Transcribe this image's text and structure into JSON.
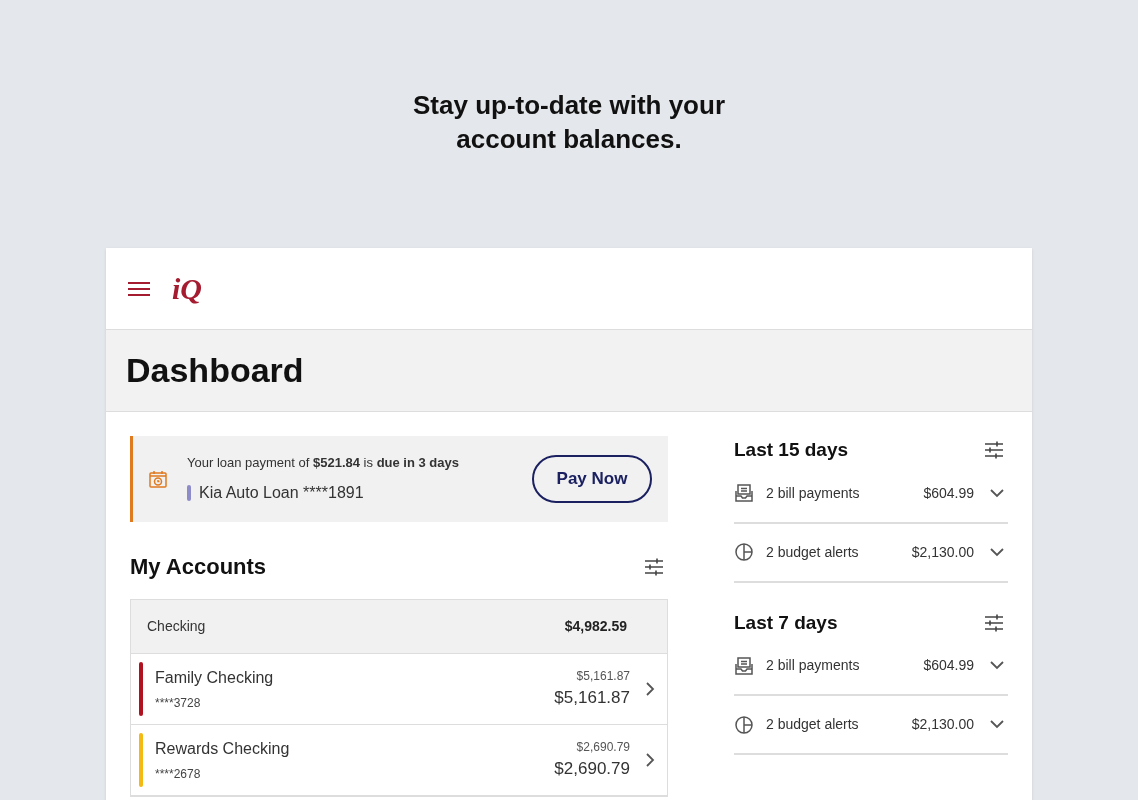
{
  "headline": "Stay up-to-date with your account balances.",
  "logo": {
    "mark": "iQ"
  },
  "page_title": "Dashboard",
  "loan_alert": {
    "message": "Your loan payment of **$521.84** is **due in 3 days**",
    "account": "Kia Auto Loan ****1891",
    "button": "Pay Now"
  },
  "accounts": {
    "title": "My Accounts",
    "group": {
      "name": "Checking",
      "total": "$4,982.59"
    },
    "items": [
      {
        "name": "Family Checking",
        "number": "****3728",
        "available": "$5,161.87",
        "balance": "$5,161.87",
        "color": "#b0121f"
      },
      {
        "name": "Rewards Checking",
        "number": "****2678",
        "available": "$2,690.79",
        "balance": "$2,690.79",
        "color": "#f5b914"
      }
    ]
  },
  "summaries": [
    {
      "title": "Last 15 days",
      "items": [
        {
          "kind": "bill",
          "label": "2 bill payments",
          "amount": "$604.99"
        },
        {
          "kind": "budget",
          "label": "2 budget alerts",
          "amount": "$2,130.00"
        }
      ]
    },
    {
      "title": "Last 7 days",
      "items": [
        {
          "kind": "bill",
          "label": "2 bill payments",
          "amount": "$604.99"
        },
        {
          "kind": "budget",
          "label": "2 budget alerts",
          "amount": "$2,130.00"
        }
      ]
    }
  ]
}
